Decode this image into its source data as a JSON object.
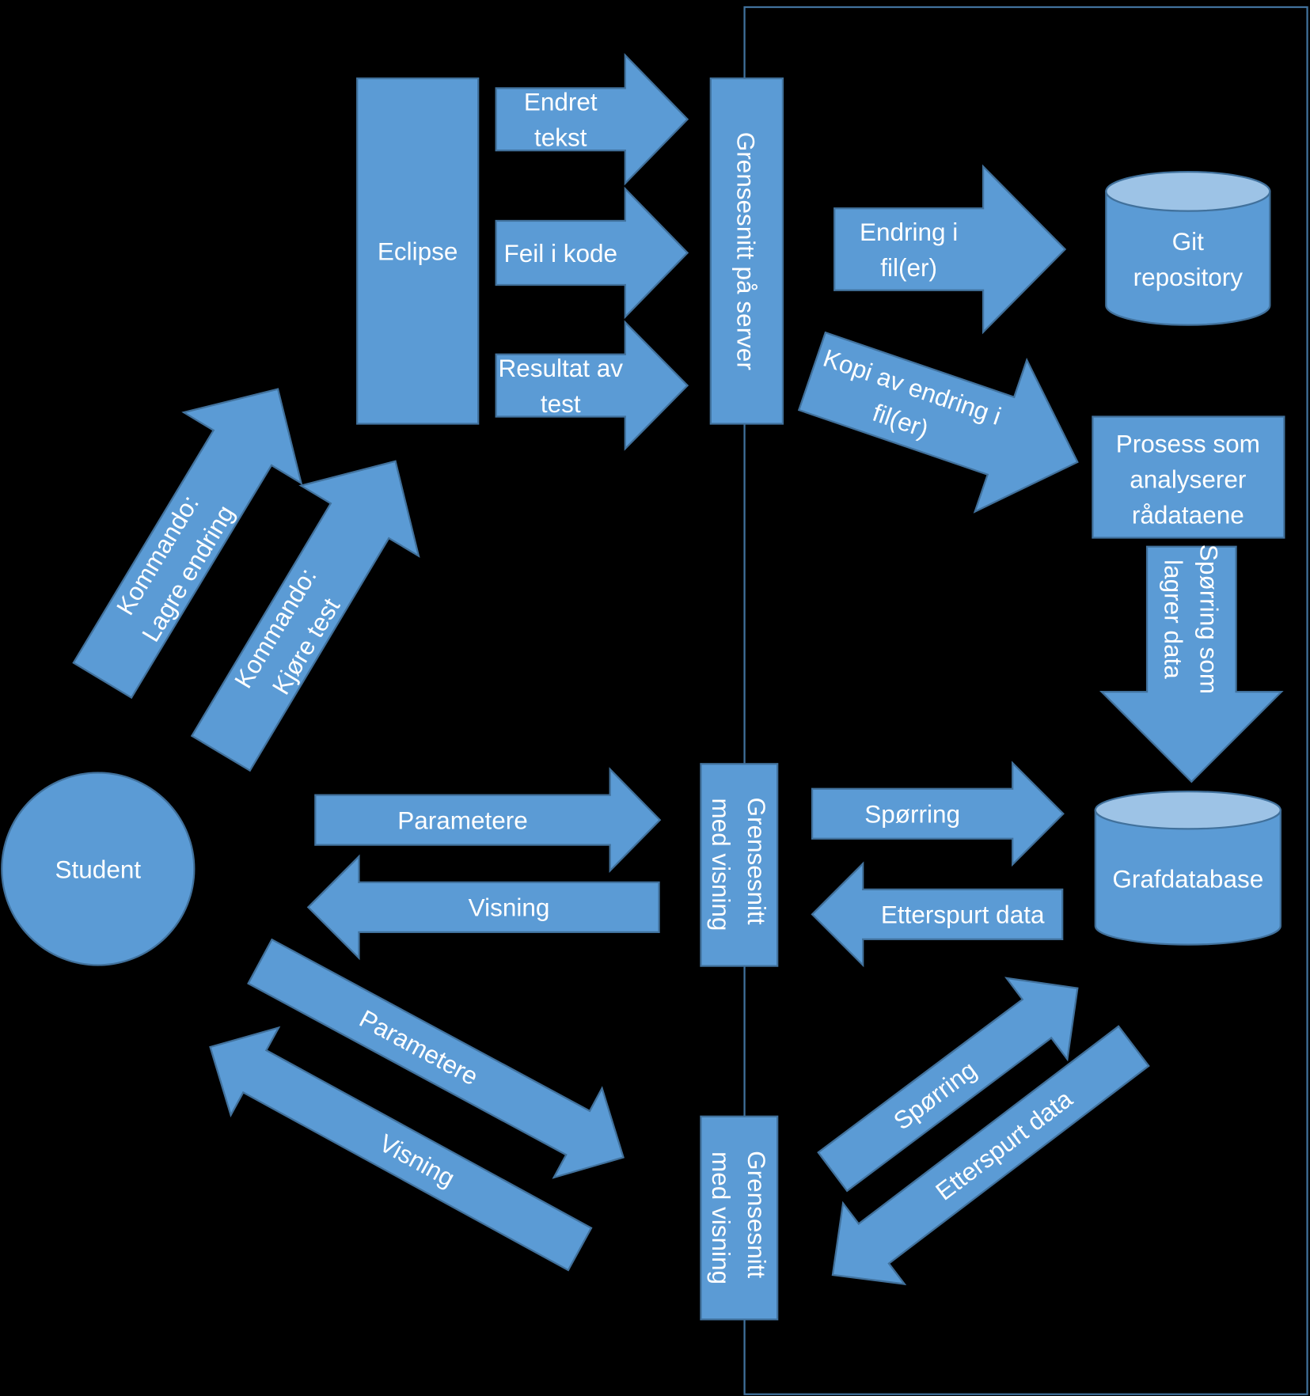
{
  "colors": {
    "background": "#000000",
    "shape_fill": "#5B9BD5",
    "shape_stroke": "#41719C",
    "cylinder_top": "#9DC3E6",
    "text": "#FFFFFF",
    "boundary_line": "#41719C"
  },
  "nodes": {
    "eclipse": "Eclipse",
    "server": "Grensesnitt på server",
    "git": [
      "Git",
      "repository"
    ],
    "process": [
      "Prosess som",
      "analyserer",
      "rådataene"
    ],
    "grafdatabase": "Grafdatabase",
    "student": "Student",
    "interface1": [
      "Grensesnitt",
      "med visning"
    ],
    "interface2": [
      "Grensesnitt",
      "med visning"
    ]
  },
  "arrows": {
    "endret_tekst": [
      "Endret",
      "tekst"
    ],
    "feil_i_kode": [
      "Feil i kode"
    ],
    "resultat_av_test": [
      "Resultat av",
      "test"
    ],
    "endring_i_filer": [
      "Endring i",
      "fil(er)"
    ],
    "kopi_av_endring": [
      "Kopi av endring i",
      "fil(er)"
    ],
    "sporring_lagrer": [
      "Spørring som",
      "lagrer data"
    ],
    "parametere": [
      "Parametere"
    ],
    "visning": [
      "Visning"
    ],
    "sporring": [
      "Spørring"
    ],
    "etterspurt_data": [
      "Etterspurt data"
    ],
    "kommando_lagre": [
      "Kommando:",
      "Lagre endring"
    ],
    "kommando_kjore": [
      "Kommando:",
      "Kjøre test"
    ],
    "parametere_diag": [
      "Parametere"
    ],
    "visning_diag": [
      "Visning"
    ],
    "sporring_diag": [
      "Spørring"
    ],
    "etterspurt_data_diag": [
      "Etterspurt data"
    ]
  }
}
